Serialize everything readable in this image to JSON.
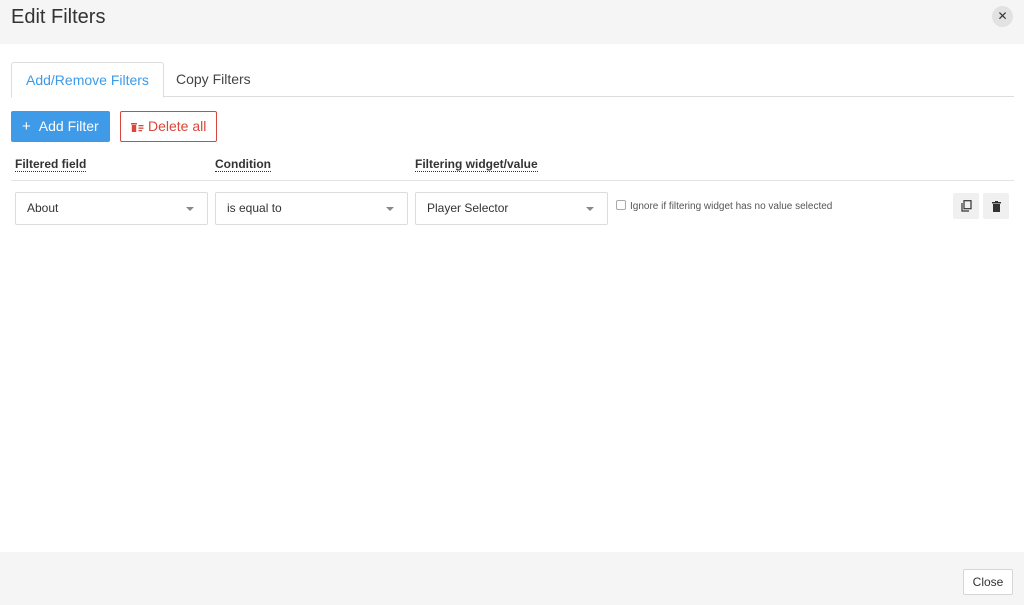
{
  "dialog": {
    "title": "Edit Filters",
    "close_glyph": "✕"
  },
  "tabs": [
    {
      "label": "Add/Remove Filters",
      "active": true
    },
    {
      "label": "Copy Filters",
      "active": false
    }
  ],
  "toolbar": {
    "add_glyph": "+",
    "add_label": "Add Filter",
    "delete_label": "Delete all"
  },
  "columns": {
    "field": "Filtered field",
    "condition": "Condition",
    "widget": "Filtering widget/value"
  },
  "filter_row": {
    "field_value": "About",
    "condition_value": "is equal to",
    "widget_value": "Player Selector",
    "ignore_label": "Ignore if filtering widget has no value selected",
    "ignore_checked": false
  },
  "icons": {
    "close": "close-icon",
    "add": "plus-icon",
    "delete_all": "trash-stack-icon",
    "dropdown": "chevron-down-icon",
    "copy": "copy-icon",
    "delete": "trash-icon"
  },
  "colors": {
    "primary": "#3f9be8",
    "danger": "#d9463a",
    "active_tab_text": "#3b9be8",
    "header_bg": "#f5f5f5"
  },
  "footer": {
    "close_label": "Close"
  }
}
